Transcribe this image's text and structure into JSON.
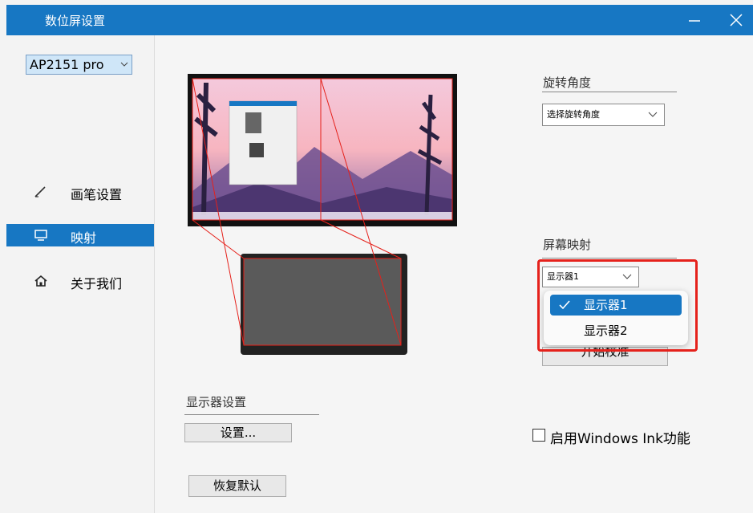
{
  "window": {
    "title": "数位屏设置"
  },
  "device": {
    "selected": "AP2151 pro"
  },
  "sidebar": {
    "items": [
      {
        "label": "画笔设置",
        "icon": "pen-icon",
        "active": false
      },
      {
        "label": "映射",
        "icon": "display-icon",
        "active": true
      },
      {
        "label": "关于我们",
        "icon": "home-icon",
        "active": false
      }
    ]
  },
  "rotation": {
    "title": "旋转角度",
    "placeholder": "选择旋转角度"
  },
  "mapping": {
    "title": "屏幕映射",
    "selected": "显示器1",
    "options": [
      "显示器1",
      "显示器2"
    ],
    "calibrate_label": "开始校准"
  },
  "display_settings": {
    "title": "显示器设置",
    "button_label": "设置..."
  },
  "restore_label": "恢复默认",
  "windows_ink": {
    "label": "启用Windows Ink功能",
    "checked": false
  },
  "colors": {
    "accent": "#1777c3",
    "highlight": "#e5211b"
  }
}
